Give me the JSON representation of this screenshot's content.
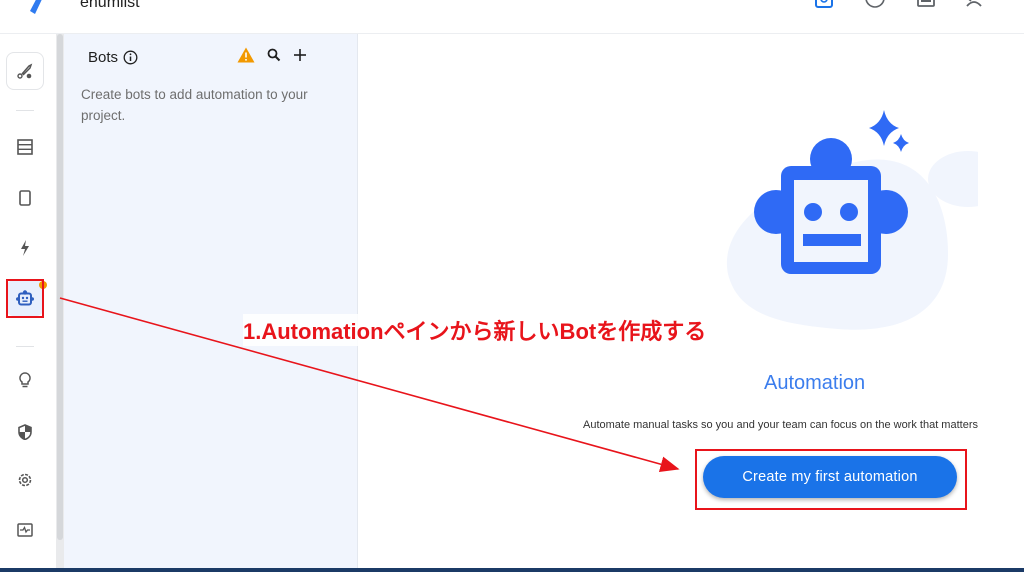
{
  "app": {
    "name": "enumlist"
  },
  "topbar": {
    "icons": [
      "preview-icon",
      "help-icon",
      "gallery-icon",
      "share-user-icon"
    ]
  },
  "rail": {
    "items": [
      {
        "icon": "launch-icon",
        "label": "Launch"
      },
      {
        "icon": "data-icon",
        "label": "Data"
      },
      {
        "icon": "app-icon",
        "label": "App"
      },
      {
        "icon": "actions-icon",
        "label": "Actions"
      },
      {
        "icon": "automation-icon",
        "label": "Automation",
        "active": true,
        "badge": true
      },
      {
        "icon": "intelligence-icon",
        "label": "Intelligence"
      },
      {
        "icon": "security-icon",
        "label": "Security"
      },
      {
        "icon": "settings-icon",
        "label": "Settings"
      },
      {
        "icon": "monitor-icon",
        "label": "Monitor"
      }
    ]
  },
  "panel": {
    "title": "Bots",
    "description": "Create bots to add automation to your project."
  },
  "main": {
    "title": "Automation",
    "description": "Automate manual tasks so you and your team can focus on the work that matters",
    "cta_label": "Create my first automation"
  },
  "annotation": {
    "text": "1.Automationペインから新しいBotを作成する",
    "color": "#e8141b"
  },
  "colors": {
    "accent": "#1a73e8",
    "robot": "#2f6af5",
    "panel_bg": "#f1f5fd",
    "warning": "#f29900"
  }
}
